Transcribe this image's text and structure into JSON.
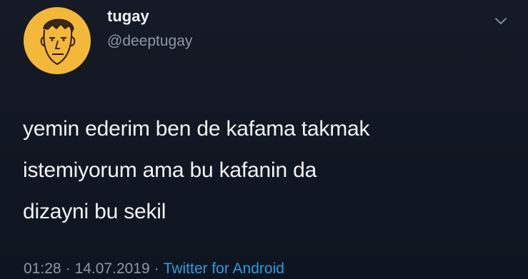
{
  "user": {
    "display_name": "tugay",
    "handle": "@deeptugay",
    "avatar_icon": "doodle-face-avatar",
    "avatar_bg": "#f3b73a"
  },
  "menu": {
    "icon": "chevron-down-icon"
  },
  "tweet": {
    "lines": [
      "yemin ederim ben de kafama takmak",
      "istemiyorum ama bu kafanin da",
      "dizayni bu sekil"
    ]
  },
  "meta": {
    "time": "01:28",
    "separator": "·",
    "date": "14.07.2019",
    "source": "Twitter for Android",
    "source_color": "#2f9bdc"
  }
}
